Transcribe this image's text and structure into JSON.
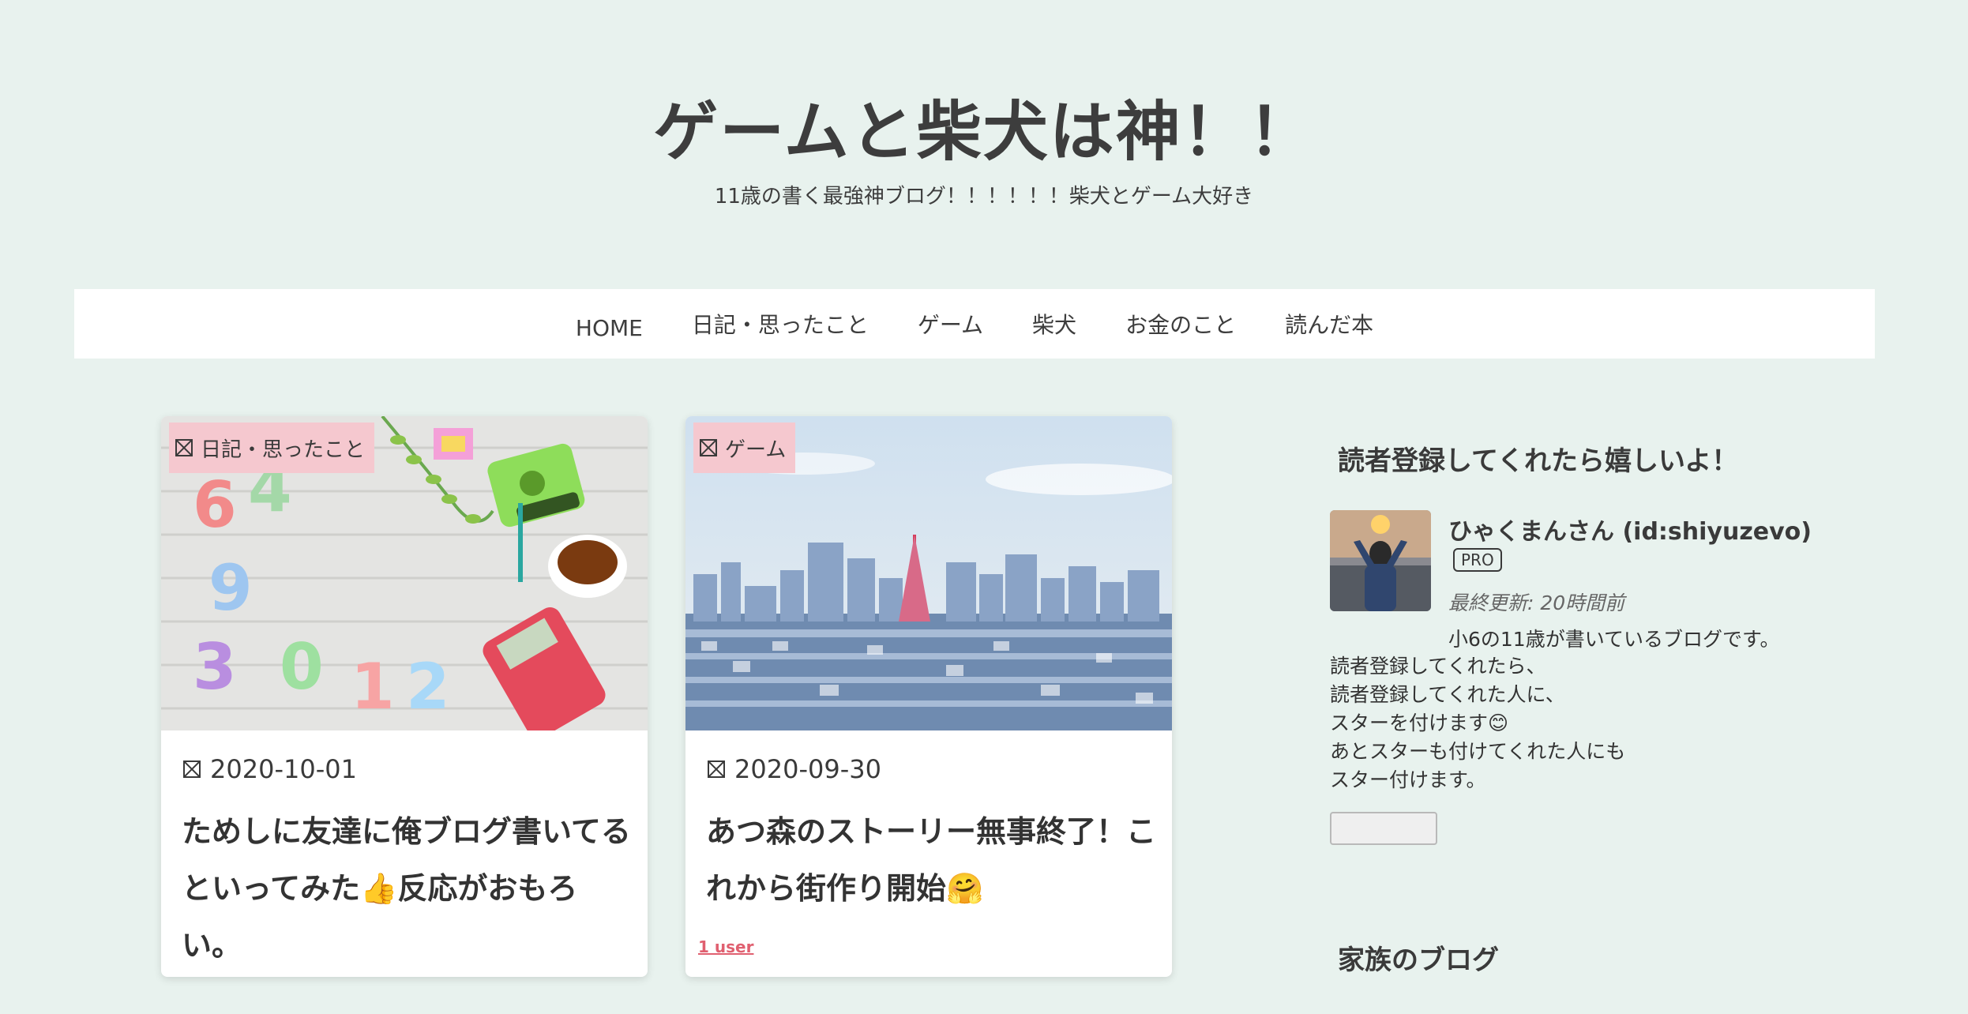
{
  "header": {
    "title": "ゲームと柴犬は神！！",
    "description": "11歳の書く最強神ブログ！！！！！！柴犬とゲーム大好き"
  },
  "nav": {
    "items": [
      "HOME",
      "日記・思ったこと",
      "ゲーム",
      "柴犬",
      "お金のこと",
      "読んだ本"
    ]
  },
  "posts": [
    {
      "category": "日記・思ったこと",
      "date": "2020-10-01",
      "title_line1": "ためしに友達に俺ブログ書いてる",
      "title_line2": "といってみた👍反応がおもろい。"
    },
    {
      "category": "ゲーム",
      "date": "2020-09-30",
      "title_line1": "あつ森のストーリー無事終了！こ",
      "title_line2": "れから街作り開始🤗",
      "users": "1 user"
    }
  ],
  "sidebar": {
    "subscribe_heading": "読者登録してくれたら嬉しいよ！",
    "username": "ひゃくまんさん (id:shiyuzevo)",
    "badge": "PRO",
    "updated": "最終更新: 20時間前",
    "description_lines": [
      "小6の11歳が書いているブログです。",
      "読者登録してくれたら、",
      "読者登録してくれた人に、",
      "スターを付けます😊",
      "あとスターも付けてくれた人にも",
      "スター付けます。"
    ],
    "family_heading": "家族のブログ"
  }
}
